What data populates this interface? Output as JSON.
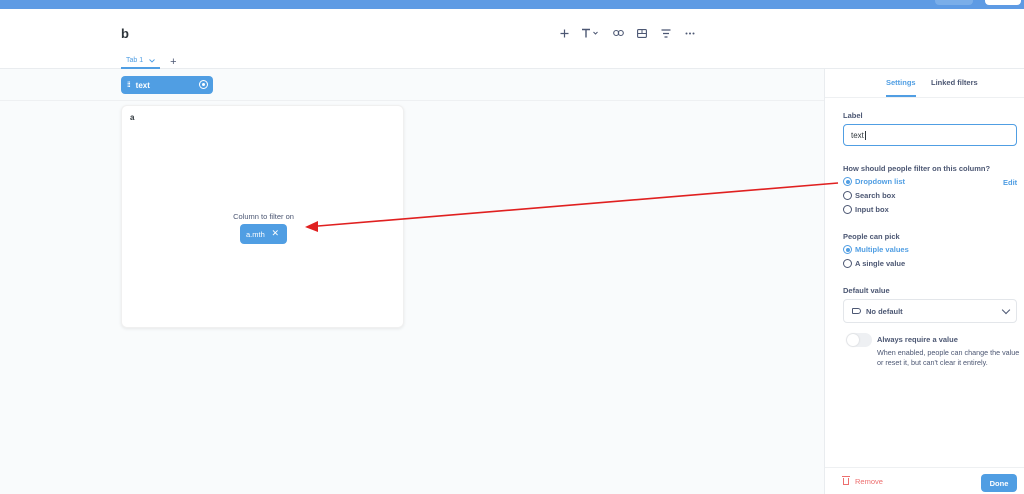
{
  "dashboard": {
    "title": "b",
    "tabs": [
      {
        "label": "Tab 1"
      }
    ],
    "add_tab_label": "+"
  },
  "toolbar": {
    "items": [
      "plus-icon",
      "text-icon",
      "link-icon",
      "section-icon",
      "filter-icon",
      "more-icon"
    ]
  },
  "filter_bar": {
    "filter_label": "text"
  },
  "card": {
    "title": "a",
    "column_label": "Column to filter on",
    "column_chip": "a.mth"
  },
  "settings_panel": {
    "tabs": [
      "Settings",
      "Linked filters"
    ],
    "active_tab": "Settings",
    "label": {
      "heading": "Label",
      "value": "text"
    },
    "filter_type": {
      "heading": "How should people filter on this column?",
      "options": [
        "Dropdown list",
        "Search box",
        "Input box"
      ],
      "selected": "Dropdown list",
      "edit_label": "Edit"
    },
    "people_can_pick": {
      "heading": "People can pick",
      "options": [
        "Multiple values",
        "A single value"
      ],
      "selected": "Multiple values"
    },
    "default_value": {
      "heading": "Default value",
      "value": "No default"
    },
    "require_value": {
      "title": "Always require a value",
      "help": "When enabled, people can change the value or reset it, but can't clear it entirely.",
      "enabled": false
    },
    "footer": {
      "remove_label": "Remove",
      "done_label": "Done"
    }
  },
  "colors": {
    "brand": "#509ee3",
    "topbar": "#5e9be4",
    "danger": "#ed6e6e",
    "annotation_arrow": "#e02020"
  }
}
